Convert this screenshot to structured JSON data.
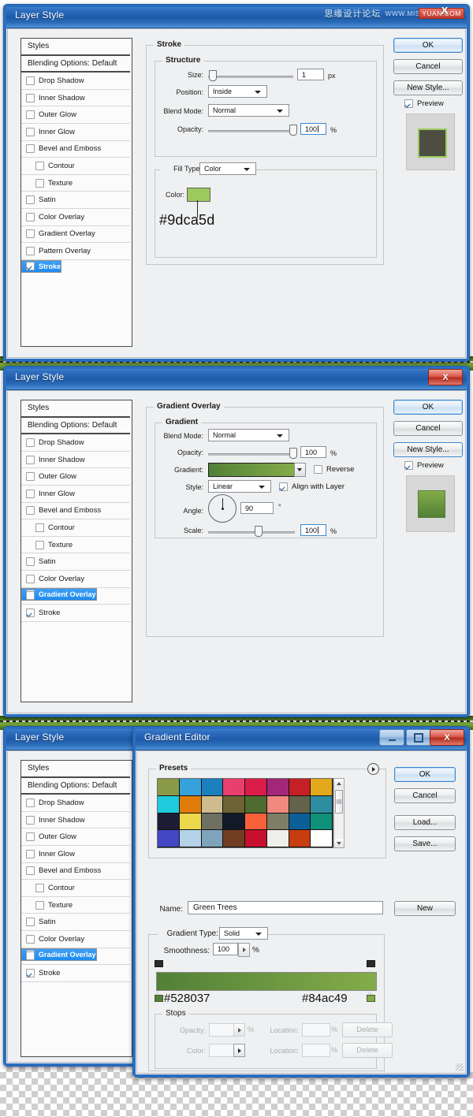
{
  "watermark": {
    "cn_text": "思缘设计论坛",
    "url_text": "WWW.MISSYUAN.COM",
    "badge_text": "YUAN.COM",
    "x_mark": "X"
  },
  "panel1": {
    "title": "Layer Style",
    "styles_list": [
      {
        "label": "Styles",
        "type": "head"
      },
      {
        "label": "Blending Options: Default",
        "type": "head2"
      },
      {
        "label": "Drop Shadow",
        "checked": false
      },
      {
        "label": "Inner Shadow",
        "checked": false
      },
      {
        "label": "Outer Glow",
        "checked": false
      },
      {
        "label": "Inner Glow",
        "checked": false
      },
      {
        "label": "Bevel and Emboss",
        "checked": false
      },
      {
        "label": "Contour",
        "checked": false,
        "sub": true
      },
      {
        "label": "Texture",
        "checked": false,
        "sub": true
      },
      {
        "label": "Satin",
        "checked": false
      },
      {
        "label": "Color Overlay",
        "checked": false
      },
      {
        "label": "Gradient Overlay",
        "checked": false
      },
      {
        "label": "Pattern Overlay",
        "checked": false
      },
      {
        "label": "Stroke",
        "checked": true,
        "selected": true
      }
    ],
    "section_title": "Stroke",
    "structure_title": "Structure",
    "size_label": "Size:",
    "size_value": "1",
    "size_unit": "px",
    "position_label": "Position:",
    "position_value": "Inside",
    "blend_label": "Blend Mode:",
    "blend_value": "Normal",
    "opacity_label": "Opacity:",
    "opacity_value": "100",
    "opacity_unit": "%",
    "filltype_label": "Fill Type:",
    "filltype_value": "Color",
    "color_label": "Color:",
    "color_hex": "#9dca5d",
    "color_hex_display": "#9dca5d",
    "ok_label": "OK",
    "cancel_label": "Cancel",
    "newstyle_label": "New Style...",
    "preview_label": "Preview",
    "preview_fill": "#4d4d42",
    "preview_stroke": "#9dca5d"
  },
  "panel2": {
    "title": "Layer Style",
    "close_label": "X",
    "styles_list": [
      {
        "label": "Styles",
        "type": "head"
      },
      {
        "label": "Blending Options: Default",
        "type": "head2"
      },
      {
        "label": "Drop Shadow",
        "checked": false
      },
      {
        "label": "Inner Shadow",
        "checked": false
      },
      {
        "label": "Outer Glow",
        "checked": false
      },
      {
        "label": "Inner Glow",
        "checked": false
      },
      {
        "label": "Bevel and Emboss",
        "checked": false
      },
      {
        "label": "Contour",
        "checked": false,
        "sub": true
      },
      {
        "label": "Texture",
        "checked": false,
        "sub": true
      },
      {
        "label": "Satin",
        "checked": false
      },
      {
        "label": "Color Overlay",
        "checked": false
      },
      {
        "label": "Gradient Overlay",
        "checked": true,
        "selected": true
      },
      {
        "label": "Pattern Overlay",
        "checked": false
      },
      {
        "label": "Stroke",
        "checked": true
      }
    ],
    "section_title": "Gradient Overlay",
    "group_title": "Gradient",
    "blend_label": "Blend Mode:",
    "blend_value": "Normal",
    "opacity_label": "Opacity:",
    "opacity_value": "100",
    "opacity_unit": "%",
    "gradient_label": "Gradient:",
    "reverse_label": "Reverse",
    "reverse_checked": false,
    "style_label": "Style:",
    "style_value": "Linear",
    "align_label": "Align with Layer",
    "align_checked": true,
    "angle_label": "Angle:",
    "angle_value": "90",
    "angle_unit": "°",
    "scale_label": "Scale:",
    "scale_value": "100",
    "scale_unit": "%",
    "gradient_start": "#528037",
    "gradient_end": "#84ac49",
    "ok_label": "OK",
    "cancel_label": "Cancel",
    "newstyle_label": "New Style...",
    "preview_label": "Preview",
    "preview_fill": "#7aa83f"
  },
  "panel3": {
    "title": "Layer Style",
    "styles_list": [
      {
        "label": "Styles",
        "type": "head"
      },
      {
        "label": "Blending Options: Default",
        "type": "head2"
      },
      {
        "label": "Drop Shadow",
        "checked": false
      },
      {
        "label": "Inner Shadow",
        "checked": false
      },
      {
        "label": "Outer Glow",
        "checked": false
      },
      {
        "label": "Inner Glow",
        "checked": false
      },
      {
        "label": "Bevel and Emboss",
        "checked": false
      },
      {
        "label": "Contour",
        "checked": false,
        "sub": true
      },
      {
        "label": "Texture",
        "checked": false,
        "sub": true
      },
      {
        "label": "Satin",
        "checked": false
      },
      {
        "label": "Color Overlay",
        "checked": false
      },
      {
        "label": "Gradient Overlay",
        "checked": true,
        "selected": true
      },
      {
        "label": "Pattern Overlay",
        "checked": false
      },
      {
        "label": "Stroke",
        "checked": true
      }
    ]
  },
  "gradient_editor": {
    "title": "Gradient Editor",
    "min_label": "",
    "max_label": "",
    "close_label": "X",
    "presets_title": "Presets",
    "preset_colors": [
      "#8a9a46",
      "#36a2db",
      "#1b80bd",
      "#e8406d",
      "#d91c48",
      "#a32778",
      "#c52026",
      "#e3a81b",
      "#1fcbdd",
      "#e07d0a",
      "#cfbb8e",
      "#6e6334",
      "#4e6b30",
      "#f0897f",
      "#63634b",
      "#2e8ea1",
      "#1d1c35",
      "#ecd84b",
      "#6f7061",
      "#111a26",
      "#f8603a",
      "#7d7e64",
      "#0b5e96",
      "#0f9079",
      "#4347c4",
      "#b4d2e8",
      "#7fa3bb",
      "#713d23",
      "#c6102d",
      "#eeeeea",
      "#c73d10",
      "#fefefe"
    ],
    "name_label": "Name:",
    "name_value": "Green Trees",
    "new_label": "New",
    "ok_label": "OK",
    "cancel_label": "Cancel",
    "load_label": "Load...",
    "save_label": "Save...",
    "gradient_type_label": "Gradient Type:",
    "gradient_type_value": "Solid",
    "smoothness_label": "Smoothness:",
    "smoothness_value": "100",
    "smoothness_unit": "%",
    "stop_left_hex": "#528037",
    "stop_right_hex": "#84ac49",
    "stops_title": "Stops",
    "opacity_label": "Opacity:",
    "opacity_value": "",
    "opacity_unit": "%",
    "opacity_location_label": "Location:",
    "opacity_location_value": "",
    "opacity_location_unit": "%",
    "opacity_delete_label": "Delete",
    "color_label": "Color:",
    "color_location_label": "Location:",
    "color_location_value": "",
    "color_location_unit": "%",
    "color_delete_label": "Delete"
  }
}
